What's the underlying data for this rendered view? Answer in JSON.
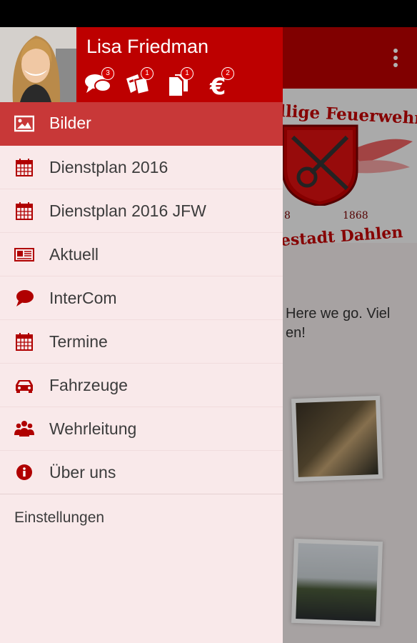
{
  "user": {
    "name": "Lisa Friedman"
  },
  "header_icons": [
    {
      "icon": "speech-bubbles-icon",
      "badge": "3"
    },
    {
      "icon": "tickets-icon",
      "badge": "1"
    },
    {
      "icon": "documents-icon",
      "badge": "1"
    },
    {
      "icon": "euro-icon",
      "badge": "2"
    }
  ],
  "menu": {
    "items": [
      {
        "label": "Bilder",
        "icon": "image-icon",
        "active": true
      },
      {
        "label": "Dienstplan 2016",
        "icon": "calendar-icon"
      },
      {
        "label": "Dienstplan 2016 JFW",
        "icon": "calendar-icon"
      },
      {
        "label": "Aktuell",
        "icon": "newspaper-icon"
      },
      {
        "label": "InterCom",
        "icon": "chat-bubble-icon"
      },
      {
        "label": "Termine",
        "icon": "calendar-icon"
      },
      {
        "label": "Fahrzeuge",
        "icon": "car-icon"
      },
      {
        "label": "Wehrleitung",
        "icon": "group-icon"
      },
      {
        "label": "Über uns",
        "icon": "info-icon"
      }
    ],
    "settings_label": "Einstellungen"
  },
  "background": {
    "banner_title": "llige Feuerwehr",
    "banner_subtitle": "estadt Dahlen",
    "banner_year_left": "8",
    "banner_year_right": "1868",
    "post_line1": "Here we go. Viel",
    "post_line2": "en!"
  },
  "colors": {
    "brand_red": "#bd0000",
    "active_row": "#c83838",
    "drawer_bg": "#f9e9ea",
    "icon_red": "#b00000"
  }
}
